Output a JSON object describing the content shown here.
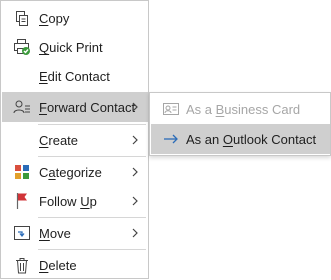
{
  "menu": {
    "items": [
      {
        "label": "Copy",
        "icon": "copy-icon",
        "underline_index": 0
      },
      {
        "label": "Quick Print",
        "icon": "quick-print-icon",
        "underline_index": 0
      },
      {
        "label": "Edit Contact",
        "icon": "",
        "underline_index": 0
      },
      {
        "label": "Forward Contact",
        "icon": "forward-contact-icon",
        "underline_index": 0,
        "has_submenu": true,
        "highlighted": true
      },
      {
        "label": "Create",
        "icon": "",
        "underline_index": 0,
        "has_submenu": true
      },
      {
        "label": "Categorize",
        "icon": "categorize-icon",
        "underline_index": 1,
        "has_submenu": true
      },
      {
        "label": "Follow Up",
        "icon": "follow-up-flag-icon",
        "underline_index": 7,
        "has_submenu": true
      },
      {
        "label": "Move",
        "icon": "move-icon",
        "underline_index": 0,
        "has_submenu": true
      },
      {
        "label": "Delete",
        "icon": "delete-icon",
        "underline_index": 0
      }
    ]
  },
  "submenu": {
    "items": [
      {
        "label": "As a Business Card",
        "icon": "business-card-icon",
        "underline_index": 5,
        "disabled": true
      },
      {
        "label": "As an Outlook Contact",
        "icon": "arrow-right-icon",
        "underline_index": 6,
        "highlighted": true
      }
    ]
  },
  "colors": {
    "highlight": "#cfcfcf",
    "accent_blue": "#2b6cb8",
    "disabled_text": "#a6a6a6",
    "flag_red": "#d13438"
  }
}
